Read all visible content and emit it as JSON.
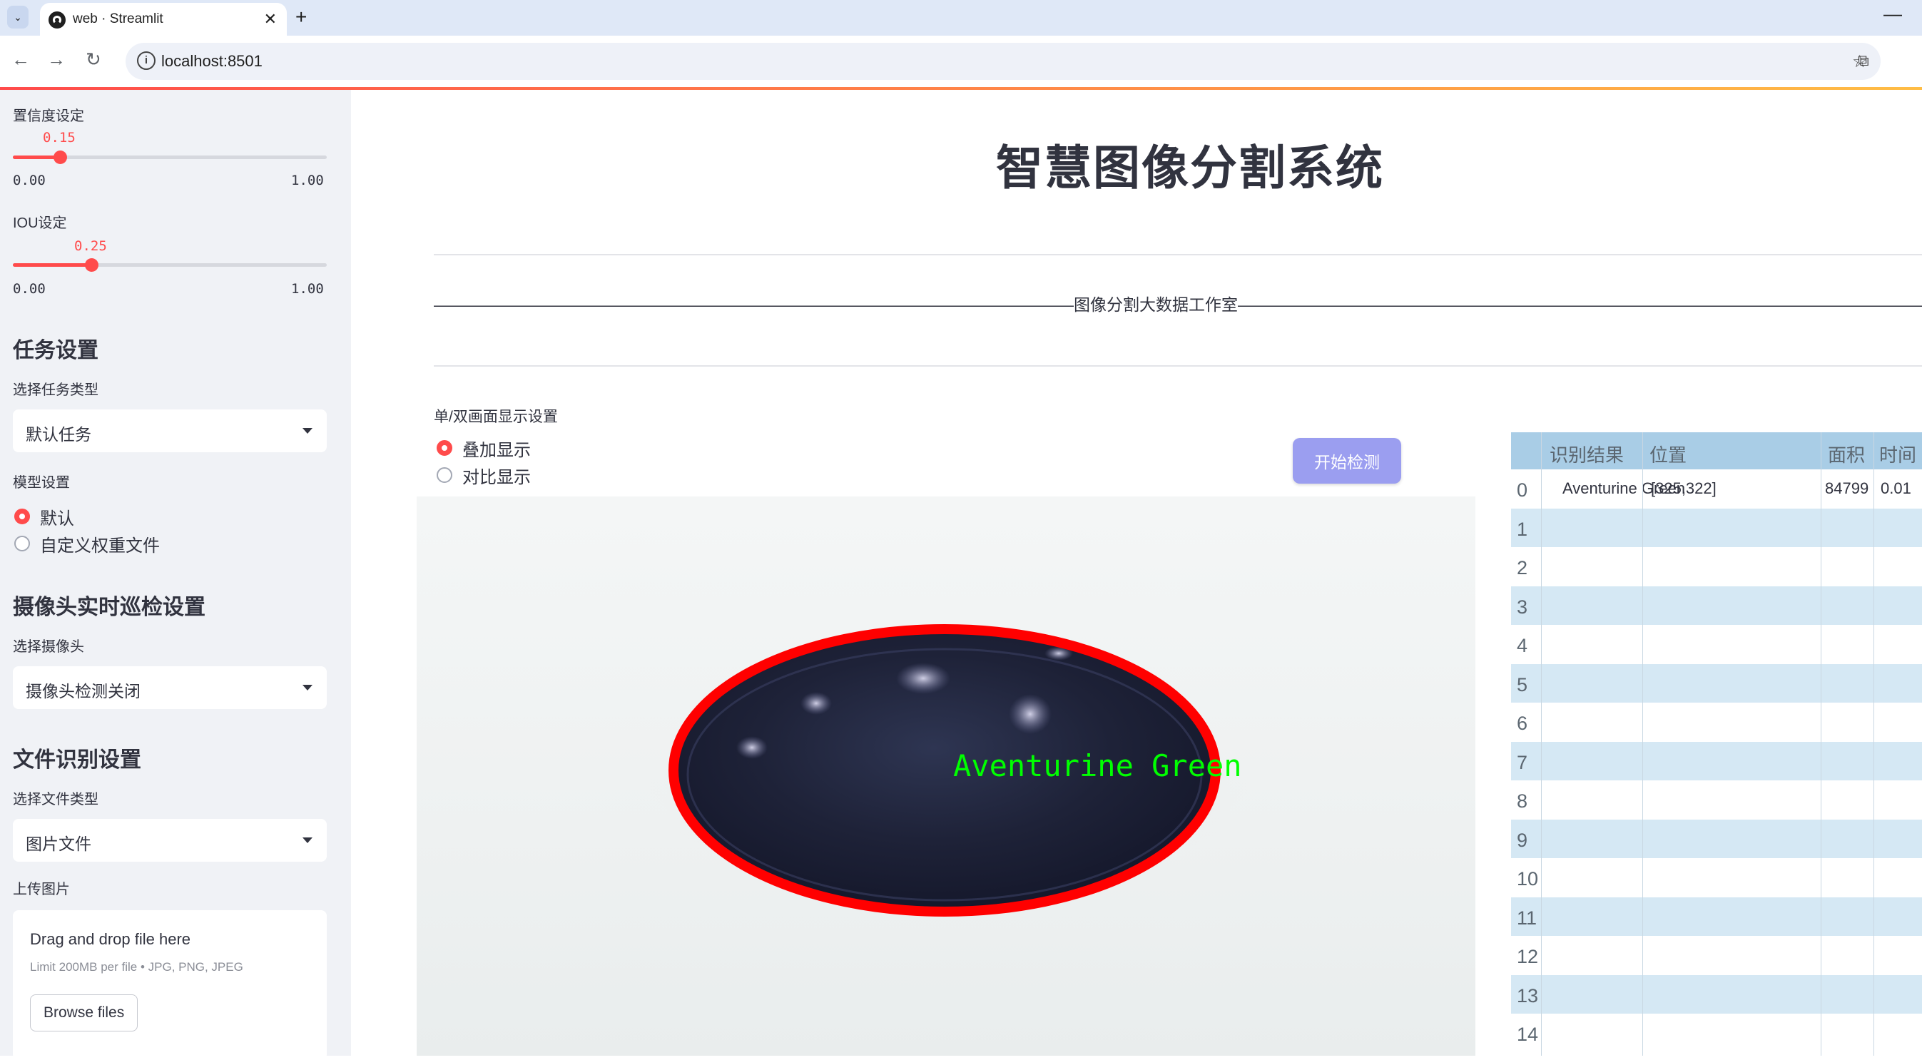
{
  "browser": {
    "tab_title": "web · Streamlit",
    "url": "localhost:8501"
  },
  "sidebar": {
    "confidence": {
      "label": "置信度设定",
      "value": "0.15",
      "min": "0.00",
      "max": "1.00",
      "fraction": 0.15
    },
    "iou": {
      "label": "IOU设定",
      "value": "0.25",
      "min": "0.00",
      "max": "1.00",
      "fraction": 0.25
    },
    "task_section": "任务设置",
    "task_type_label": "选择任务类型",
    "task_type_value": "默认任务",
    "model_label": "模型设置",
    "model_options": [
      "默认",
      "自定义权重文件"
    ],
    "model_selected": "默认",
    "camera_section": "摄像头实时巡检设置",
    "camera_label": "选择摄像头",
    "camera_value": "摄像头检测关闭",
    "file_section": "文件识别设置",
    "file_type_label": "选择文件类型",
    "file_type_value": "图片文件",
    "upload_label": "上传图片",
    "upload_title": "Drag and drop file here",
    "upload_limit": "Limit 200MB per file • JPG, PNG, JPEG",
    "browse_button": "Browse files"
  },
  "main": {
    "title": "智慧图像分割系统",
    "studio": "———————————————————————————————————————图像分割大数据工作室——————————————————————————————————————————",
    "display_mode_label": "单/双画面显示设置",
    "display_options": [
      "叠加显示",
      "对比显示"
    ],
    "display_selected": "叠加显示",
    "detect_button": "开始检测",
    "detection_label": "Aventurine Green"
  },
  "table": {
    "headers": [
      "识别结果",
      "位置",
      "面积",
      "时间"
    ],
    "rows": [
      {
        "index": "0",
        "result": "Aventurine Green",
        "position": "[325,322]",
        "area": "84799",
        "time": "0.01"
      },
      {
        "index": "1"
      },
      {
        "index": "2"
      },
      {
        "index": "3"
      },
      {
        "index": "4"
      },
      {
        "index": "5"
      },
      {
        "index": "6"
      },
      {
        "index": "7"
      },
      {
        "index": "8"
      },
      {
        "index": "9"
      },
      {
        "index": "10"
      },
      {
        "index": "11"
      },
      {
        "index": "12"
      },
      {
        "index": "13"
      },
      {
        "index": "14"
      }
    ]
  },
  "colors": {
    "accent": "#ff4b4b",
    "button": "#9b9ef0",
    "table_header": "#a9cde6",
    "table_stripe": "#d5e8f4",
    "mask_outline": "#ff0000",
    "label_green": "#00ff00"
  }
}
